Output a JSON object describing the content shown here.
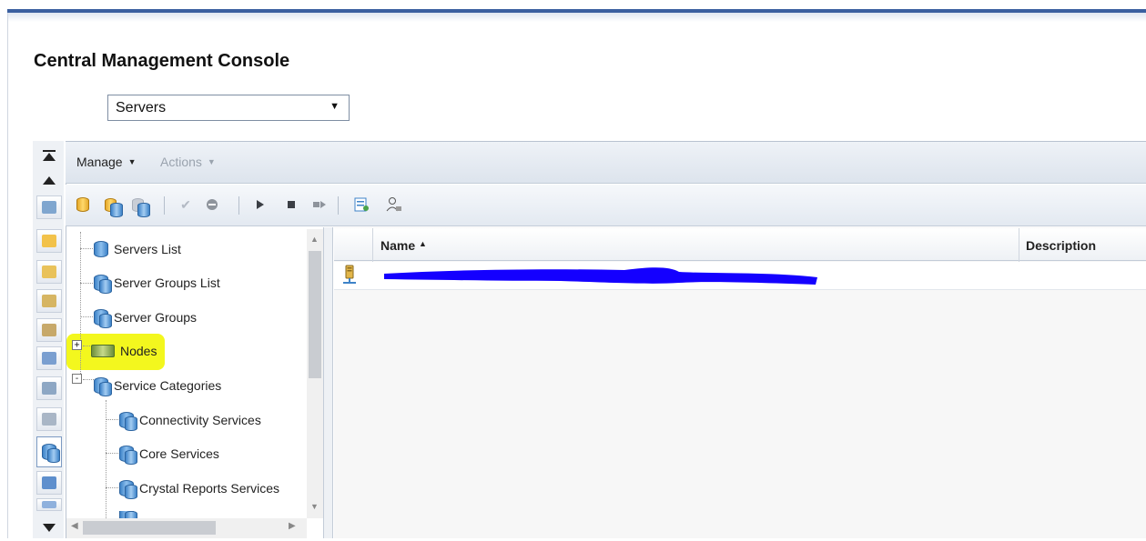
{
  "app": {
    "title": "Central Management Console"
  },
  "navigation": {
    "selected": "Servers"
  },
  "menubar": {
    "manage": "Manage",
    "actions": "Actions"
  },
  "tree": {
    "items": [
      {
        "label": "Servers List"
      },
      {
        "label": "Server Groups List"
      },
      {
        "label": "Server Groups"
      },
      {
        "label": "Nodes",
        "highlighted": true,
        "expander": "+"
      },
      {
        "label": "Service Categories",
        "expander": "-"
      },
      {
        "label": "Connectivity Services"
      },
      {
        "label": "Core Services"
      },
      {
        "label": "Crystal Reports Services"
      }
    ]
  },
  "grid": {
    "columns": [
      {
        "label": "Name",
        "sort": "ascending"
      },
      {
        "label": "Description"
      }
    ],
    "rows": [
      {
        "name_redacted": true,
        "description": ""
      }
    ]
  },
  "colors": {
    "accent": "#3a5fa0",
    "highlight": "#f3f71e",
    "redaction": "#1400ff"
  }
}
